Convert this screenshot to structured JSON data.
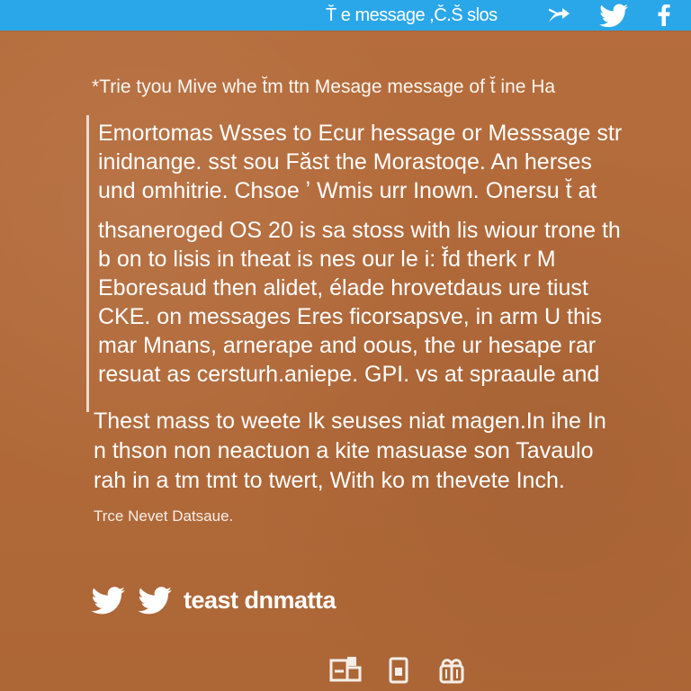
{
  "topbar": {
    "title": "T̆ e message ,C̆.S̆ slos",
    "actions": {
      "share_icon": "share-icon",
      "twitter_icon": "twitter-icon",
      "facebook_icon": "facebook-icon"
    }
  },
  "post": {
    "intro": "*Trie tyou Mive whe t̆m ttn Mesage message of t̆ ine Ha",
    "quote": {
      "paragraph1": [
        "Emortomas Wsses to Ecur hessage or Messsage str",
        "inidnange. sst sou Făst the Morastoqe. An herses",
        "und omhitrie. Chsoe ʼ Wmis urr Inown. Onersu t̆ at"
      ],
      "paragraph2": [
        "thsaneroged OS 20 is sa stoss with lis wiour trone th",
        "b on to lisis in theat is nes our le  i: f̆d therk  r M",
        "Eboresaud then alidet, élade hrovetdaus ure tiust",
        "CKE.   on messages Eres ficorsapsve,  in arm U this",
        "mar Mnans, arnerape and oous,  the ur  hesape rar",
        "resuat as cersturh.aniepe. GPI.    vs at spraaule and"
      ]
    },
    "body": [
      "Thest mass to weete Ik seuses niat magen.In ihe In",
      "n    thson non neactuon a kite masuase son Tavaulo",
      "rah in a tm tmt to twert, With ko m  thevete Inch."
    ],
    "source": "Trce Nevet  Datsaue.",
    "brand": {
      "label": "teast dnmatta",
      "icons": [
        "twitter-icon",
        "twitter-icon"
      ]
    }
  },
  "footer": {
    "icons": [
      "layout-icon",
      "device-icon",
      "gift-icon"
    ]
  },
  "colors": {
    "background": "#b26a3b",
    "topbar": "#2aa7e8",
    "text": "#ffffff"
  }
}
